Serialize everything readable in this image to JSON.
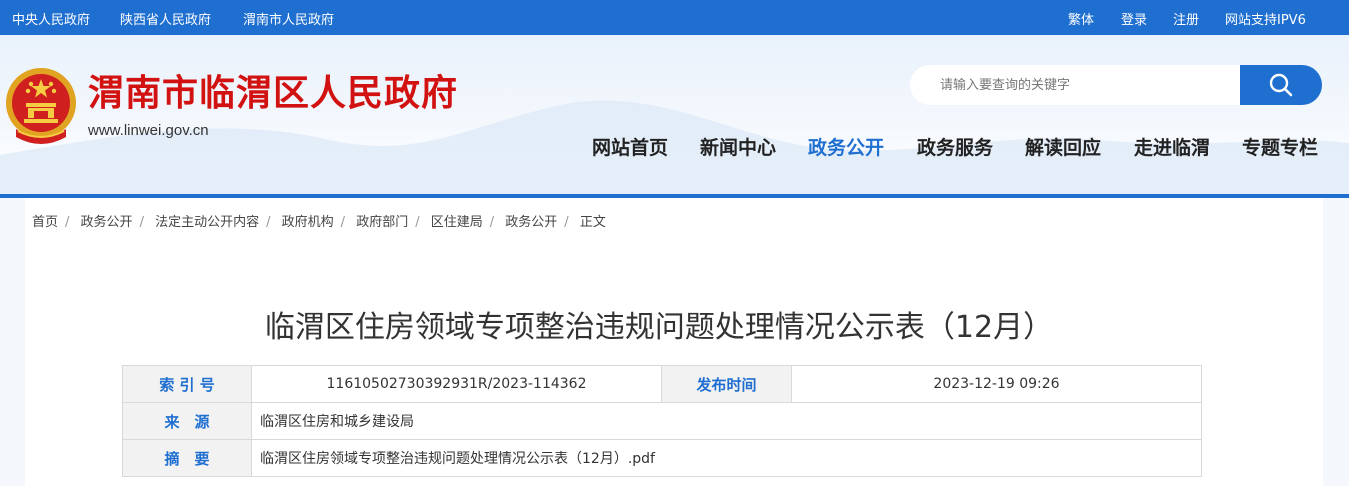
{
  "topbar": {
    "left_links": [
      "中央人民政府",
      "陕西省人民政府",
      "渭南市人民政府"
    ],
    "right_links": [
      "繁体",
      "登录",
      "注册",
      "网站支持IPV6"
    ]
  },
  "header": {
    "site_title": "渭南市临渭区人民政府",
    "site_url": "www.linwei.gov.cn",
    "search_placeholder": "请输入要查询的关键字",
    "search_icon": "search-icon"
  },
  "nav": {
    "items": [
      "网站首页",
      "新闻中心",
      "政务公开",
      "政务服务",
      "解读回应",
      "走进临渭",
      "专题专栏"
    ],
    "active": "政务公开"
  },
  "breadcrumb": [
    "首页",
    "政务公开",
    "法定主动公开内容",
    "政府机构",
    "政府部门",
    "区住建局",
    "政务公开",
    "正文"
  ],
  "article": {
    "title": "临渭区住房领域专项整治违规问题处理情况公示表（12月）"
  },
  "meta": {
    "index_label": "索 引 号",
    "index_value": "11610502730392931R/2023-114362",
    "publish_label": "发布时间",
    "publish_value": "2023-12-19 09:26",
    "source_label": "来　源",
    "source_value": "临渭区住房和城乡建设局",
    "summary_label": "摘　要",
    "summary_value": "临渭区住房领域专项整治违规问题处理情况公示表（12月）.pdf"
  },
  "colors": {
    "primary_blue": "#1f6fd1",
    "title_red": "#d21111"
  }
}
